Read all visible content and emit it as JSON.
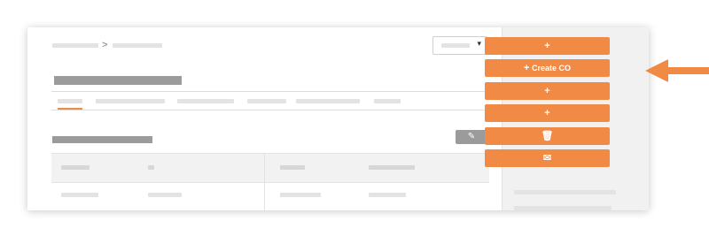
{
  "breadcrumb": {
    "separator": ">"
  },
  "dropdown": {
    "caret": "▾"
  },
  "edit_button": {
    "icon": "pencil-icon",
    "glyph": "✎"
  },
  "actions": [
    {
      "label": "",
      "icon": "plus-icon",
      "glyph": "+"
    },
    {
      "label": "Create CO",
      "icon": "plus-icon",
      "glyph": "+"
    },
    {
      "label": "",
      "icon": "plus-icon",
      "glyph": "+"
    },
    {
      "label": "",
      "icon": "plus-icon",
      "glyph": "+"
    },
    {
      "label": "",
      "icon": "trash-icon",
      "glyph": "🗑"
    },
    {
      "label": "",
      "icon": "envelope-icon",
      "glyph": "✉"
    }
  ],
  "colors": {
    "accent": "#f08a45",
    "placeholder": "#e3e3e3",
    "secondary_button": "#9b9b9b"
  }
}
